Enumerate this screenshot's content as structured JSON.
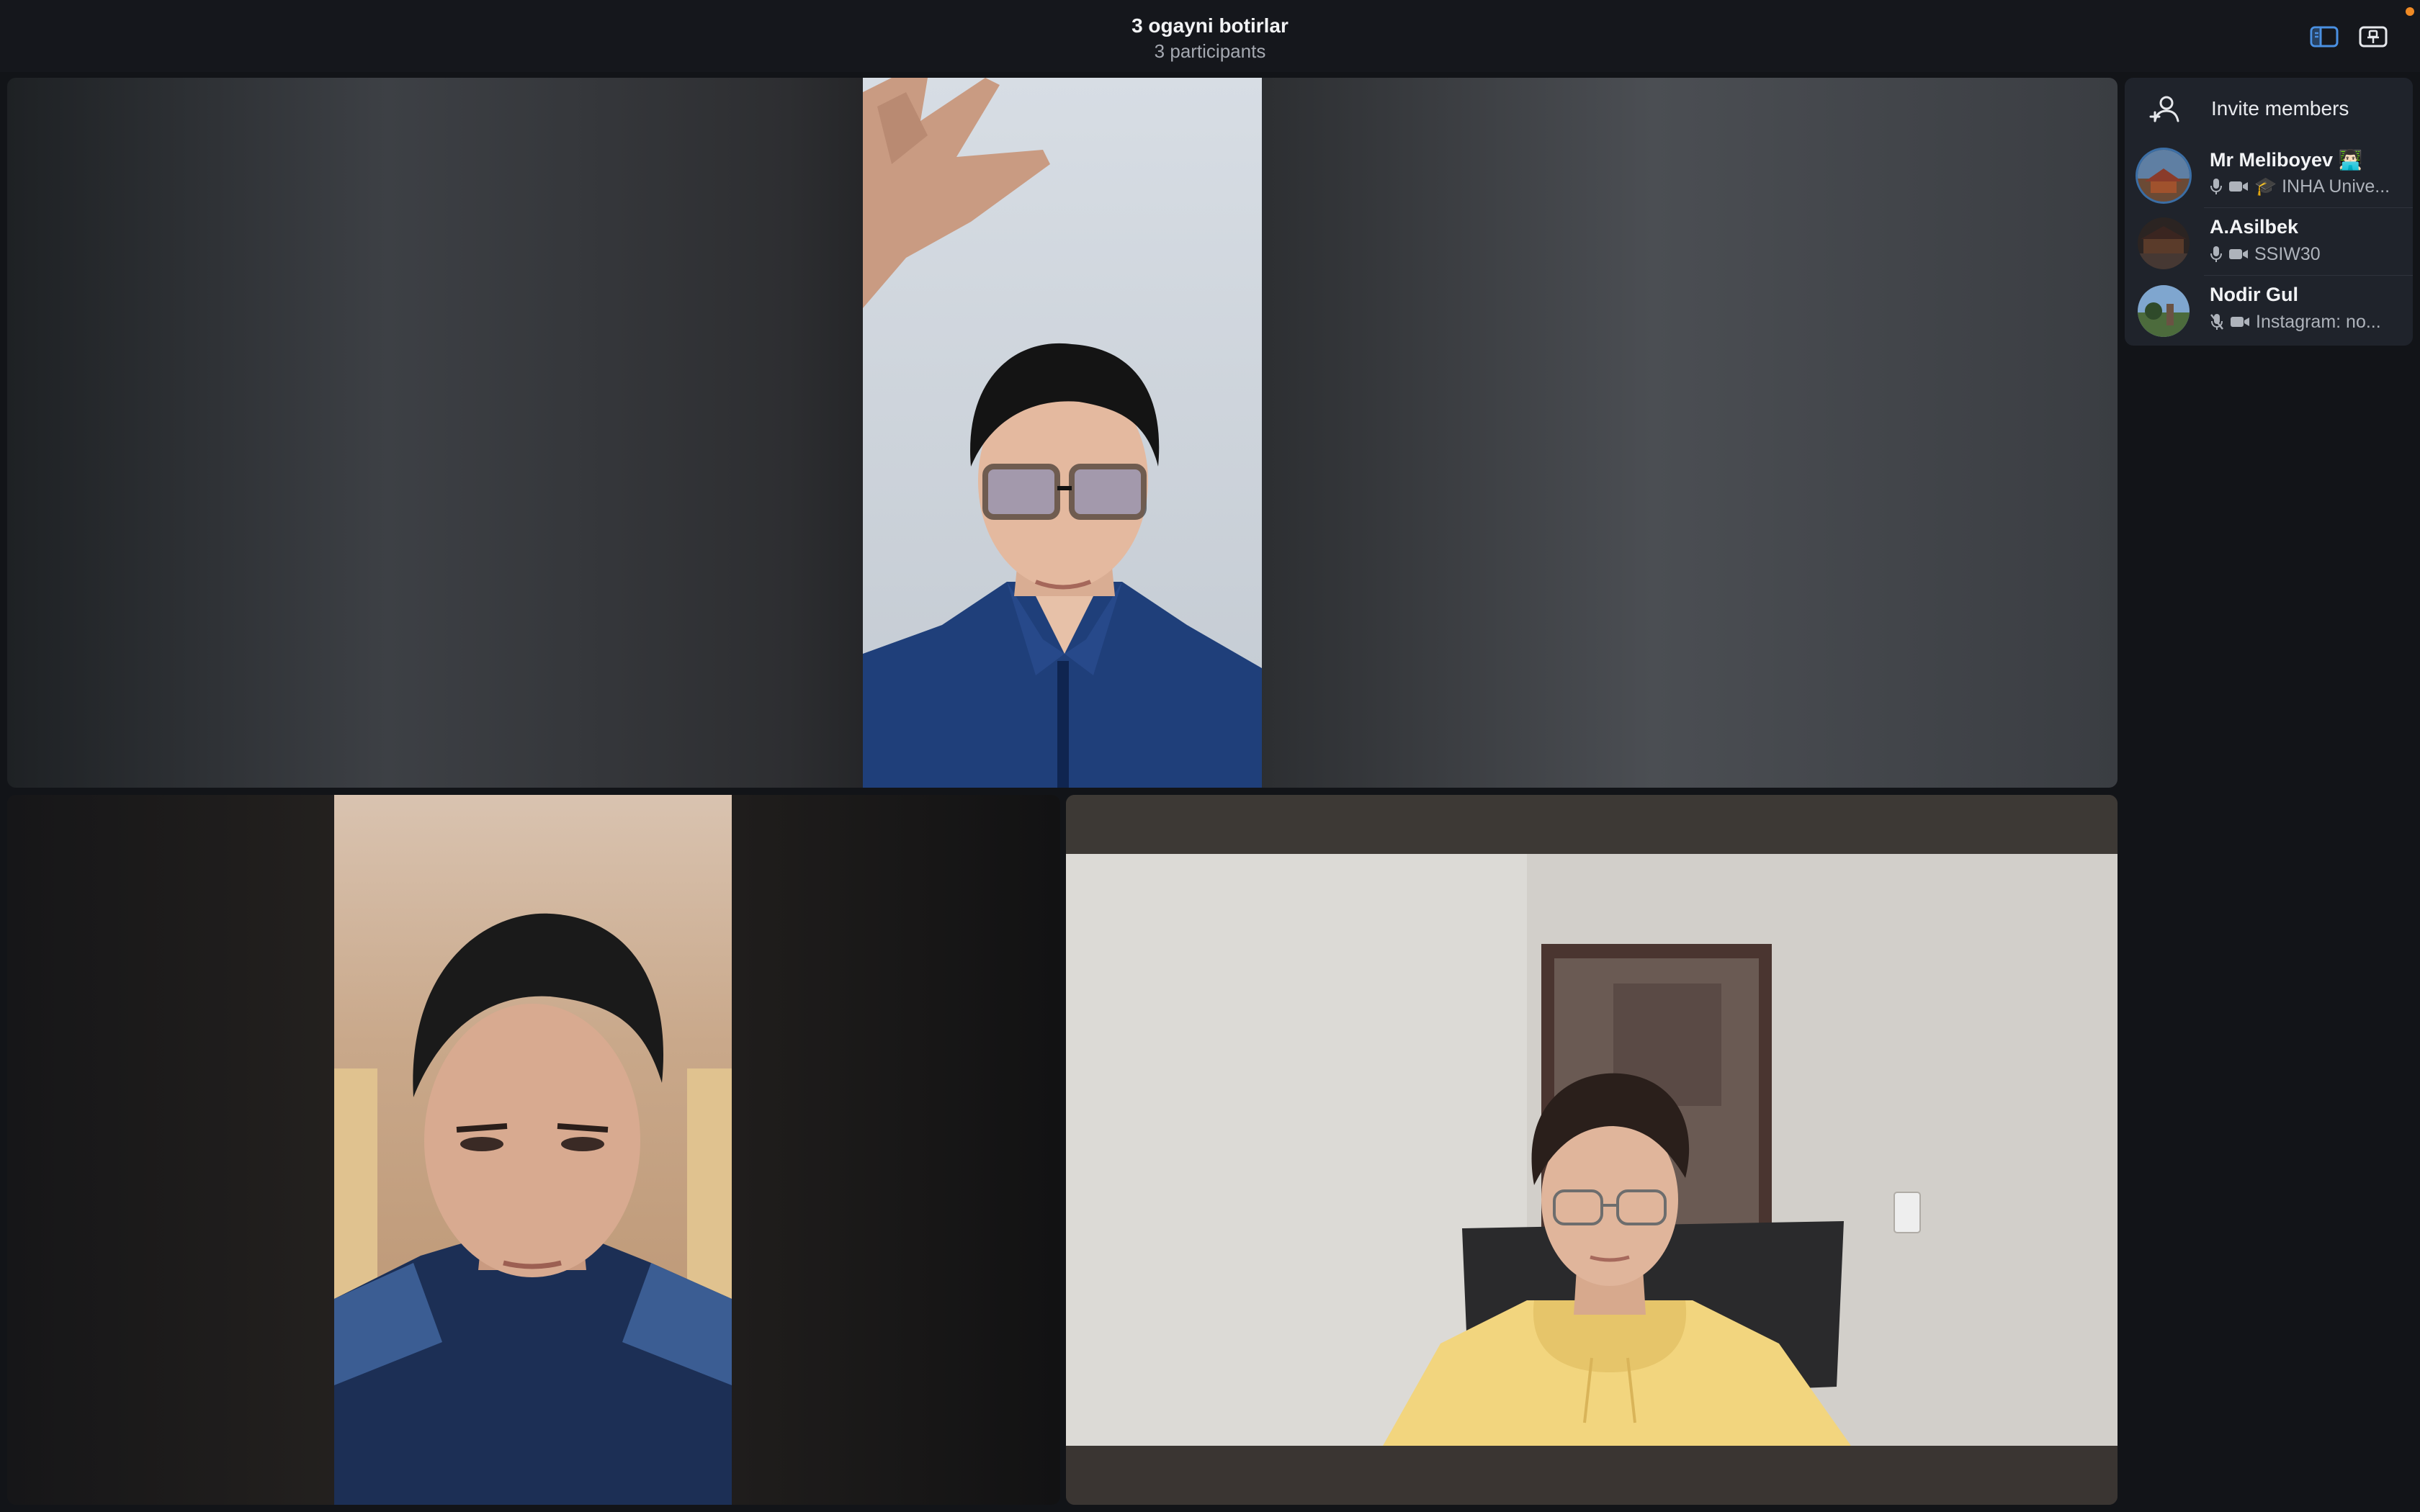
{
  "header": {
    "title": "3 ogayni botirlar",
    "subtitle": "3 participants",
    "buttons": [
      {
        "icon": "sidebar-toggle-icon",
        "active": true
      },
      {
        "icon": "pin-window-icon"
      }
    ],
    "notification_color": "#f08a24"
  },
  "sidebar": {
    "invite_label": "Invite members",
    "members": [
      {
        "name": "Mr Meliboyev",
        "name_emoji": "👨🏻‍💻",
        "status": "🎓 INHA Unive...",
        "mic": "on",
        "camera": "on",
        "avatar": "photo"
      },
      {
        "name": "A.Asilbek",
        "status": "SSIW30",
        "mic": "on",
        "camera": "on",
        "avatar": "photo"
      },
      {
        "name": "Nodir Gul",
        "status": "Instagram: no...",
        "mic": "off",
        "camera": "on",
        "avatar": "photo"
      }
    ]
  },
  "video_tiles": [
    {
      "id": "top",
      "participant_hidden": true
    },
    {
      "id": "bottom-left",
      "participant_hidden": true
    },
    {
      "id": "bottom-right",
      "participant_hidden": true
    }
  ],
  "colors": {
    "background": "#121418",
    "panel": "#1f232b",
    "accent": "#3b82f6",
    "muted_text": "#aeb3bb"
  }
}
